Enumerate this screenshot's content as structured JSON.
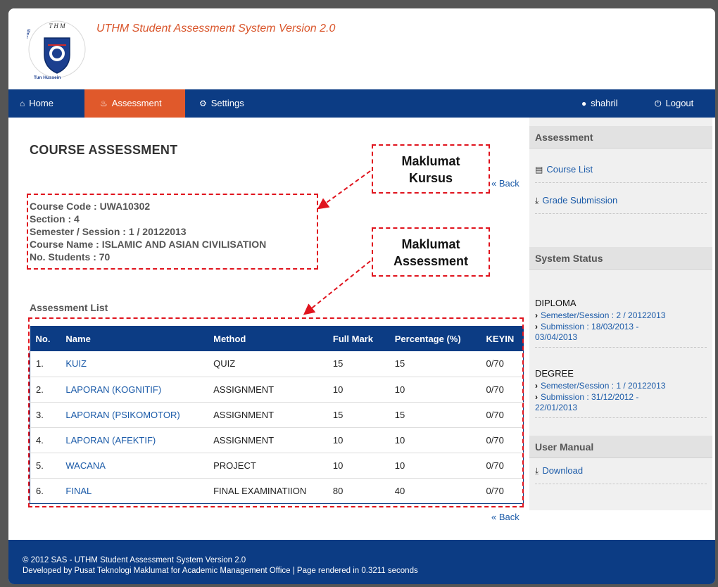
{
  "header": {
    "title": "UTHM Student Assessment System Version 2.0",
    "logo_text_top": "T H M",
    "logo_text_ring": "Universiti Tun Hussein Onn Malaysia"
  },
  "nav": {
    "home": "Home",
    "assessment": "Assessment",
    "settings": "Settings",
    "user": "shahril",
    "logout": "Logout"
  },
  "main": {
    "title": "COURSE ASSESSMENT",
    "back": "« Back",
    "course_code": "Course Code : UWA10302",
    "section": "Section : 4",
    "semester": "Semester / Session : 1 / 20122013",
    "course_name": "Course Name : ISLAMIC AND ASIAN CIVILISATION",
    "students": "No. Students : 70",
    "list_label": "Assessment List",
    "columns": [
      "No.",
      "Name",
      "Method",
      "Full Mark",
      "Percentage (%)",
      "KEYIN"
    ],
    "rows": [
      {
        "no": "1.",
        "name": "KUIZ",
        "method": "QUIZ",
        "full": "15",
        "pct": "15",
        "keyin": "0/70"
      },
      {
        "no": "2.",
        "name": "LAPORAN (KOGNITIF)",
        "method": "ASSIGNMENT",
        "full": "10",
        "pct": "10",
        "keyin": "0/70"
      },
      {
        "no": "3.",
        "name": "LAPORAN (PSIKOMOTOR)",
        "method": "ASSIGNMENT",
        "full": "15",
        "pct": "15",
        "keyin": "0/70"
      },
      {
        "no": "4.",
        "name": "LAPORAN (AFEKTIF)",
        "method": "ASSIGNMENT",
        "full": "10",
        "pct": "10",
        "keyin": "0/70"
      },
      {
        "no": "5.",
        "name": "WACANA",
        "method": "PROJECT",
        "full": "10",
        "pct": "10",
        "keyin": "0/70"
      },
      {
        "no": "6.",
        "name": "FINAL",
        "method": "FINAL EXAMINATIION",
        "full": "80",
        "pct": "40",
        "keyin": "0/70"
      }
    ]
  },
  "annotations": {
    "kursus_line1": "Maklumat",
    "kursus_line2": "Kursus",
    "assessment_line1": "Maklumat",
    "assessment_line2": "Assessment"
  },
  "sidebar": {
    "assessment_head": "Assessment",
    "course_list": "Course List",
    "grade_submission": "Grade Submission",
    "status_head": "System Status",
    "diploma": "DIPLOMA",
    "diploma_sem": "Semester/Session : 2 / 20122013",
    "diploma_sub1": "Submission : 18/03/2013 -",
    "diploma_sub2": "03/04/2013",
    "degree": "DEGREE",
    "degree_sem": "Semester/Session : 1 / 20122013",
    "degree_sub1": "Submission : 31/12/2012 -",
    "degree_sub2": "22/01/2013",
    "manual_head": "User Manual",
    "download": "Download"
  },
  "footer": {
    "line1": "© 2012 SAS - UTHM Student Assessment System Version 2.0",
    "line2": "Developed by Pusat Teknologi Maklumat for Academic Management Office | Page rendered in 0.3211 seconds"
  },
  "colors": {
    "nav_bg": "#0c3c84",
    "active_tab": "#e0592b",
    "link": "#1a5aa8",
    "annotation": "#e0141e"
  },
  "icons": {
    "home": "home-icon",
    "assessment": "fire-icon",
    "settings": "gear-icon",
    "user": "user-icon",
    "logout": "power-icon",
    "course_list": "list-icon",
    "grade_submission": "download-icon",
    "download": "download-icon"
  }
}
